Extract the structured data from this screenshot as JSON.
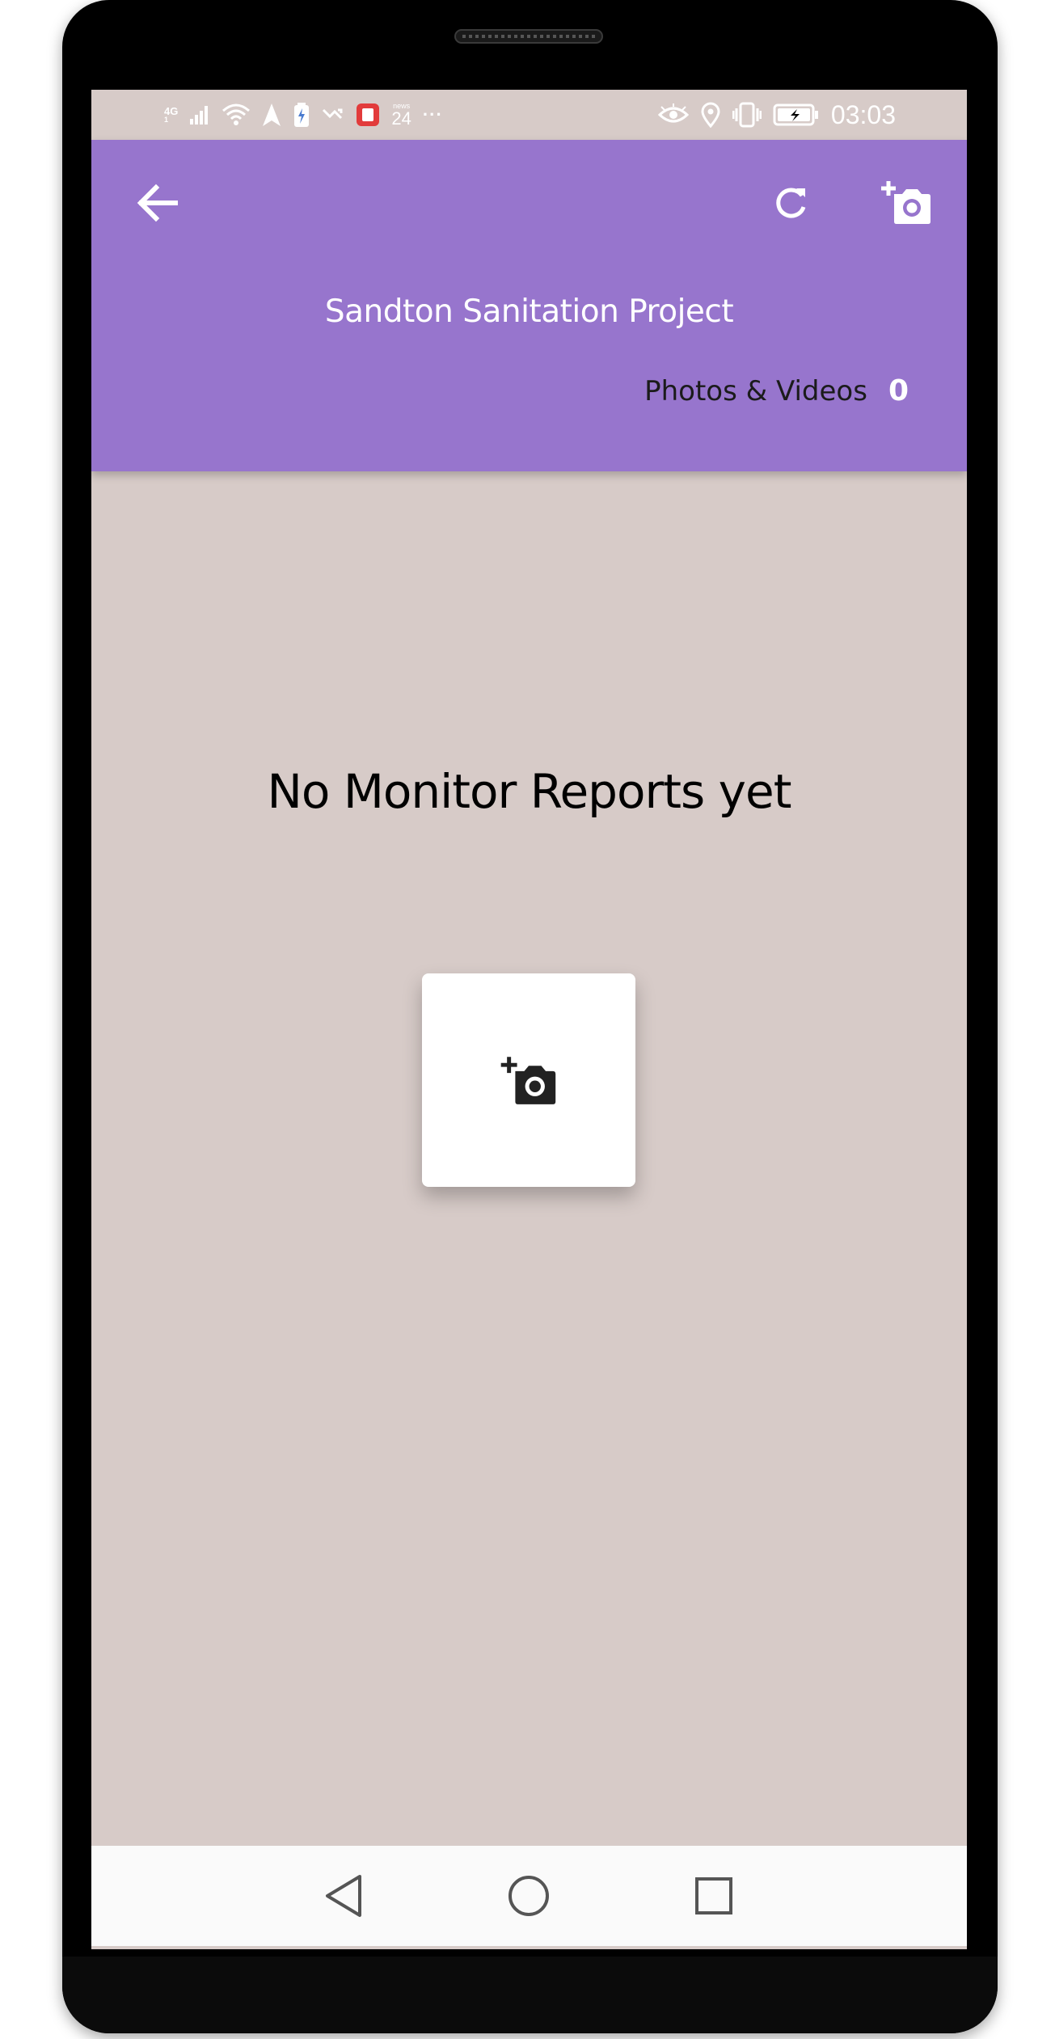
{
  "status_bar": {
    "network_type": "4G",
    "network_subtype": "1",
    "news_label": "news",
    "news_number": "24",
    "more_indicator": "···",
    "time": "03:03",
    "left_icons": [
      "network-4g-icon",
      "signal-icon",
      "wifi-icon",
      "location-arrow-icon",
      "battery-saver-icon",
      "missed-call-icon",
      "notification-app-icon",
      "news24-icon",
      "more-dots-icon"
    ],
    "right_icons": [
      "eye-comfort-icon",
      "location-pin-icon",
      "vibrate-icon",
      "battery-charging-icon"
    ]
  },
  "app_bar": {
    "background_color": "#9775cd",
    "back_icon": "arrow-back-icon",
    "refresh_icon": "refresh-icon",
    "add_photo_icon": "add-a-photo-icon",
    "title": "Sandton Sanitation Project",
    "media_label": "Photos & Videos",
    "media_count": "0"
  },
  "main": {
    "background_color": "#d7cbc8",
    "empty_message": "No Monitor Reports yet",
    "add_button_icon": "add-a-photo-icon"
  },
  "nav_bar": {
    "icons": [
      "nav-back-triangle-icon",
      "nav-home-circle-icon",
      "nav-recents-square-icon"
    ]
  }
}
